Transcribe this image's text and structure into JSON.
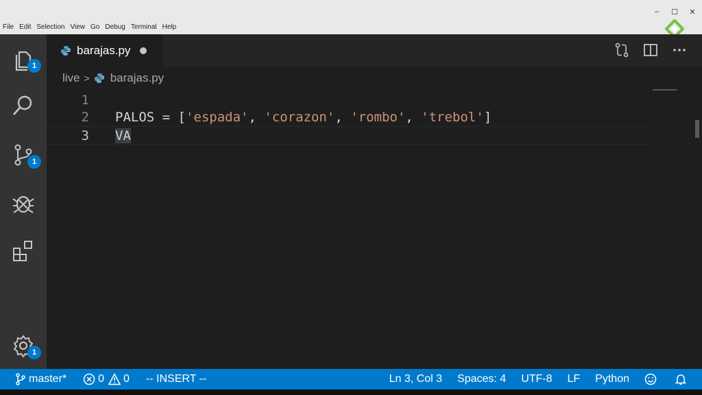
{
  "menu": [
    "File",
    "Edit",
    "Selection",
    "View",
    "Go",
    "Debug",
    "Terminal",
    "Help"
  ],
  "window_controls": {
    "minimize": "–",
    "maximize": "☐",
    "close": "✕"
  },
  "activity_bar": {
    "explorer_badge": "1",
    "scm_badge": "1",
    "settings_badge": "1"
  },
  "tab": {
    "filename": "barajas.py"
  },
  "breadcrumb": {
    "folder": "live",
    "separator": ">",
    "file": "barajas.py"
  },
  "editor": {
    "lines": [
      {
        "number": "1",
        "tokens": []
      },
      {
        "number": "2",
        "tokens": [
          {
            "text": "PALOS = [",
            "kind": "plain"
          },
          {
            "text": "'espada'",
            "kind": "string"
          },
          {
            "text": ", ",
            "kind": "plain"
          },
          {
            "text": "'corazon'",
            "kind": "string"
          },
          {
            "text": ", ",
            "kind": "plain"
          },
          {
            "text": "'rombo'",
            "kind": "string"
          },
          {
            "text": ", ",
            "kind": "plain"
          },
          {
            "text": "'trebol'",
            "kind": "string"
          },
          {
            "text": "]",
            "kind": "plain"
          }
        ]
      },
      {
        "number": "3",
        "tokens": [
          {
            "text": "VA",
            "kind": "selected"
          }
        ]
      }
    ]
  },
  "status": {
    "branch": "master*",
    "errors": "0",
    "warnings": "0",
    "mode": "-- INSERT --",
    "cursor": "Ln 3, Col 3",
    "spaces": "Spaces: 4",
    "encoding": "UTF-8",
    "eol": "LF",
    "language": "Python"
  },
  "colors": {
    "activity_bar": "#333333",
    "editor_bg": "#1e1e1e",
    "status_bar": "#007acc",
    "string": "#ce9178",
    "badge": "#007acc"
  }
}
